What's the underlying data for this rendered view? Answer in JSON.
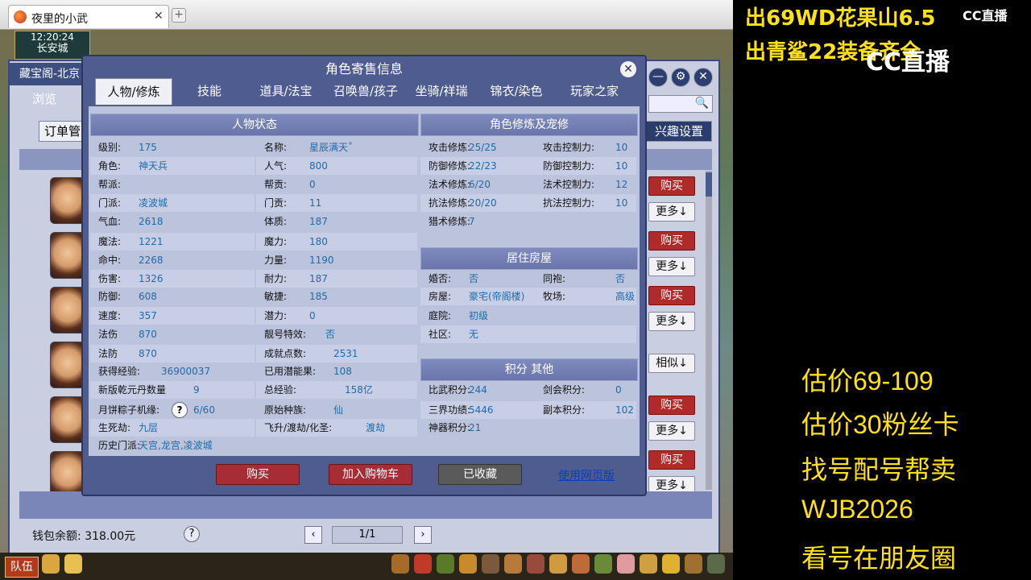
{
  "browser": {
    "tab_title": "夜里的小武",
    "tab_close": "✕",
    "new_tab": "+"
  },
  "clock": {
    "time": "12:20:24",
    "city": "长安城"
  },
  "back_panel": {
    "title": "藏宝阁-北京",
    "browse": "浏览",
    "order": "订单管",
    "interest": "兴趣设置",
    "buttons": [
      "购买",
      "更多↓",
      "购买",
      "更多↓",
      "购买",
      "更多↓",
      "相似↓",
      "购买",
      "更多↓",
      "购买",
      "更多↓"
    ],
    "wallet": "钱包余额: 318.00元",
    "help": "?",
    "page": "1/1",
    "prev": "‹",
    "next": "›",
    "ctrl_min": "—",
    "ctrl_gear": "⚙",
    "ctrl_close": "✕",
    "search_icon": "🔍"
  },
  "dialog": {
    "title": "角色寄售信息",
    "close": "✕",
    "tabs": [
      "人物/修炼",
      "技能",
      "道具/法宝",
      "召唤兽/孩子",
      "坐骑/祥瑞",
      "锦衣/染色",
      "玩家之家"
    ],
    "sections": {
      "status": "人物状态",
      "cultivation": "角色修炼及宠修",
      "house": "居住房屋",
      "points": "积分 其他"
    },
    "status_left": [
      {
        "k": "级别:",
        "v": "175"
      },
      {
        "k": "角色:",
        "v": "神天兵"
      },
      {
        "k": "帮派:",
        "v": ""
      },
      {
        "k": "门派:",
        "v": "凌波城"
      },
      {
        "k": "气血:",
        "v": "2618"
      },
      {
        "k": "魔法:",
        "v": "1221"
      },
      {
        "k": "命中:",
        "v": "2268"
      },
      {
        "k": "伤害:",
        "v": "1326"
      },
      {
        "k": "防御:",
        "v": "608"
      },
      {
        "k": "速度:",
        "v": "357"
      },
      {
        "k": "法伤",
        "v": "870"
      },
      {
        "k": "法防",
        "v": "870"
      },
      {
        "k": "获得经验:",
        "v": "36900037"
      },
      {
        "k": "新版乾元丹数量",
        "v": "9"
      },
      {
        "k": "月饼粽子机缘:",
        "v": "6/60"
      },
      {
        "k": "生死劫:",
        "v": "九层"
      },
      {
        "k": "历史门派:",
        "v": "天宫,龙宫,凌波城"
      }
    ],
    "status_right": [
      {
        "k": "名称:",
        "v": "星辰满天˚"
      },
      {
        "k": "人气:",
        "v": "800"
      },
      {
        "k": "帮贡:",
        "v": "0"
      },
      {
        "k": "门贡:",
        "v": "11"
      },
      {
        "k": "体质:",
        "v": "187"
      },
      {
        "k": "魔力:",
        "v": "180"
      },
      {
        "k": "力量:",
        "v": "1190"
      },
      {
        "k": "耐力:",
        "v": "187"
      },
      {
        "k": "敏捷:",
        "v": "185"
      },
      {
        "k": "潜力:",
        "v": "0"
      },
      {
        "k": "靓号特效:",
        "v": "否"
      },
      {
        "k": "成就点数:",
        "v": "2531"
      },
      {
        "k": "已用潜能果:",
        "v": "108"
      },
      {
        "k": "总经验:",
        "v": "158亿"
      },
      {
        "k": "原始种族:",
        "v": "仙"
      },
      {
        "k": "飞升/渡劫/化圣:",
        "v": "渡劫"
      }
    ],
    "cultivation": [
      {
        "k1": "攻击修炼:",
        "v1": "25/25",
        "k2": "攻击控制力:",
        "v2": "10"
      },
      {
        "k1": "防御修炼:",
        "v1": "22/23",
        "k2": "防御控制力:",
        "v2": "10"
      },
      {
        "k1": "法术修炼:",
        "v1": "6/20",
        "k2": "法术控制力:",
        "v2": "12"
      },
      {
        "k1": "抗法修炼:",
        "v1": "20/20",
        "k2": "抗法控制力:",
        "v2": "10"
      },
      {
        "k1": "猎术修炼:",
        "v1": "7",
        "k2": "",
        "v2": ""
      }
    ],
    "house": [
      {
        "k1": "婚否:",
        "v1": "否",
        "k2": "同袍:",
        "v2": "否"
      },
      {
        "k1": "房屋:",
        "v1": "豪宅(帝阁楼)",
        "k2": "牧场:",
        "v2": "高级"
      },
      {
        "k1": "庭院:",
        "v1": "初级",
        "k2": "",
        "v2": ""
      },
      {
        "k1": "社区:",
        "v1": "无",
        "k2": "",
        "v2": ""
      }
    ],
    "points": [
      {
        "k1": "比武积分:",
        "v1": "244",
        "k2": "剑会积分:",
        "v2": "0"
      },
      {
        "k1": "三界功绩:",
        "v1": "5446",
        "k2": "副本积分:",
        "v2": "102"
      },
      {
        "k1": "神器积分:",
        "v1": "21",
        "k2": "",
        "v2": ""
      }
    ],
    "q_mark": "?",
    "buttons": {
      "buy": "购买",
      "cart": "加入购物车",
      "fav": "已收藏",
      "web": "使用网页版"
    }
  },
  "taskbar": {
    "team": "队伍"
  },
  "overlay": {
    "line1": "出69WD花果山6.5",
    "line2": "出青鲨22装备齐全",
    "cc_small": "CC直播",
    "cc_big": "CC直播",
    "right": [
      "估价69-109",
      "估价30粉丝卡",
      "找号配号帮卖",
      " WJB2026",
      "看号在朋友圈"
    ]
  }
}
